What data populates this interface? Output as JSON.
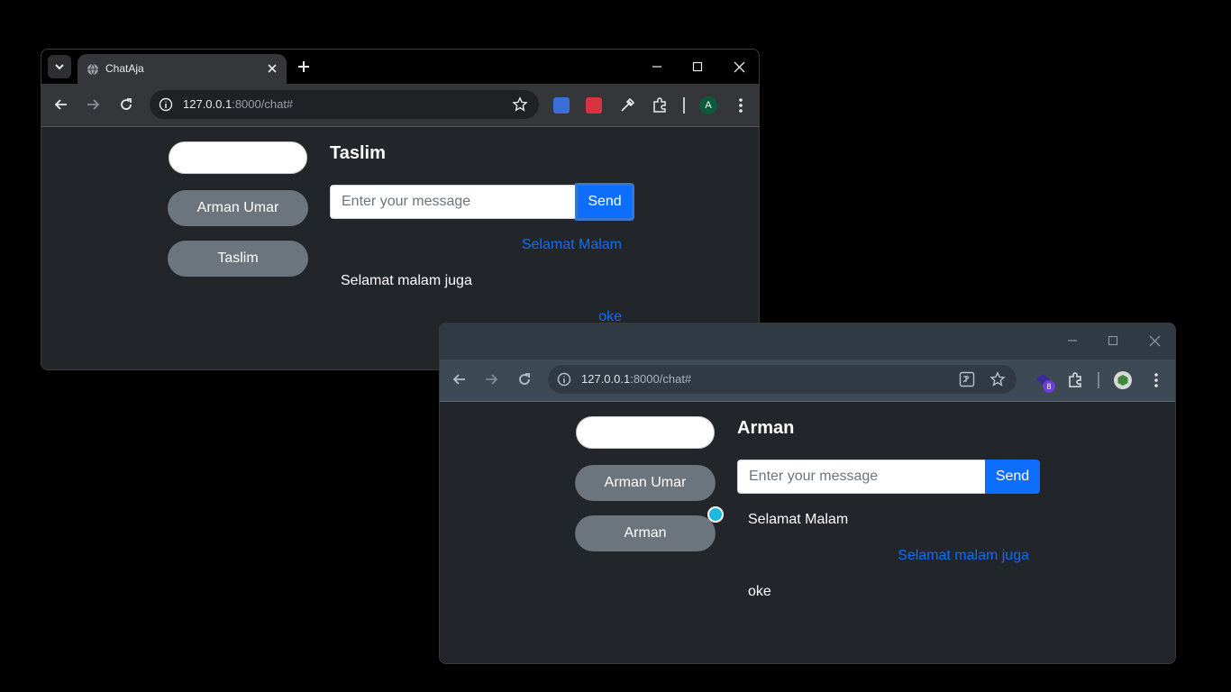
{
  "window_a": {
    "tab_title": "ChatAja",
    "url_host": "127.0.0.1",
    "url_rest": ":8000/chat#",
    "avatar_letter": "A",
    "chat": {
      "contacts": [
        "Arman Umar",
        "Taslim"
      ],
      "title": "Taslim",
      "input_placeholder": "Enter your message",
      "send_label": "Send",
      "messages": [
        {
          "text": "Selamat Malam",
          "side": "sent"
        },
        {
          "text": "Selamat malam juga",
          "side": "recv"
        },
        {
          "text": "oke",
          "side": "sent"
        }
      ]
    }
  },
  "window_b": {
    "url_host": "127.0.0.1",
    "url_rest": ":8000/chat#",
    "ext_badge": "8",
    "chat": {
      "contacts": [
        "Arman Umar",
        "Arman"
      ],
      "title": "Arman",
      "input_placeholder": "Enter your message",
      "send_label": "Send",
      "messages": [
        {
          "text": "Selamat Malam",
          "side": "recv"
        },
        {
          "text": "Selamat malam juga",
          "side": "sent"
        },
        {
          "text": "oke",
          "side": "recv"
        }
      ]
    }
  },
  "colors": {
    "send_button": "#0d6efd",
    "sent_text": "#0d6efd",
    "contact_button": "#6c757d",
    "page_bg": "#222529",
    "cursor": "#1eb8e0"
  }
}
